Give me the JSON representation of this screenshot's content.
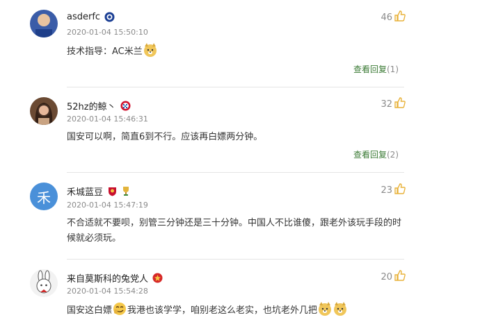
{
  "comments": [
    {
      "username": "asderfc",
      "time": "2020-01-04 15:50:10",
      "likes": "46",
      "text": "技术指导：AC米兰",
      "reply_label": "查看回复",
      "reply_count": "(1)",
      "badges": [
        "chelsea-badge"
      ]
    },
    {
      "username": "52hz的鲸丶",
      "time": "2020-01-04 15:46:31",
      "likes": "32",
      "text": "国安可以啊，简直6到不行。应该再白嫖两分钟。",
      "reply_label": "查看回复",
      "reply_count": "(2)",
      "badges": [
        "bayern-badge"
      ]
    },
    {
      "username": "禾城蓝豆",
      "avatar_char": "禾",
      "time": "2020-01-04 15:47:19",
      "likes": "23",
      "text": "不合适就不要呗，别管三分钟还是三十分钟。中国人不比谁傻，跟老外该玩手段的时候就必须玩。",
      "badges": [
        "club-badge",
        "trophy-badge"
      ]
    },
    {
      "username": "来自莫斯科的兔党人",
      "time": "2020-01-04 15:54:28",
      "likes": "20",
      "text_part1": "国安这白嫖",
      "text_part2": "我港也该学学，",
      "text_part3": "咱别老这么老实，也坑老外几把",
      "badges": [
        "shanghai-badge"
      ]
    }
  ],
  "colors": {
    "like_icon": "#e8b23a",
    "reply_link": "#3a7a34",
    "time": "#8a8a8a"
  }
}
